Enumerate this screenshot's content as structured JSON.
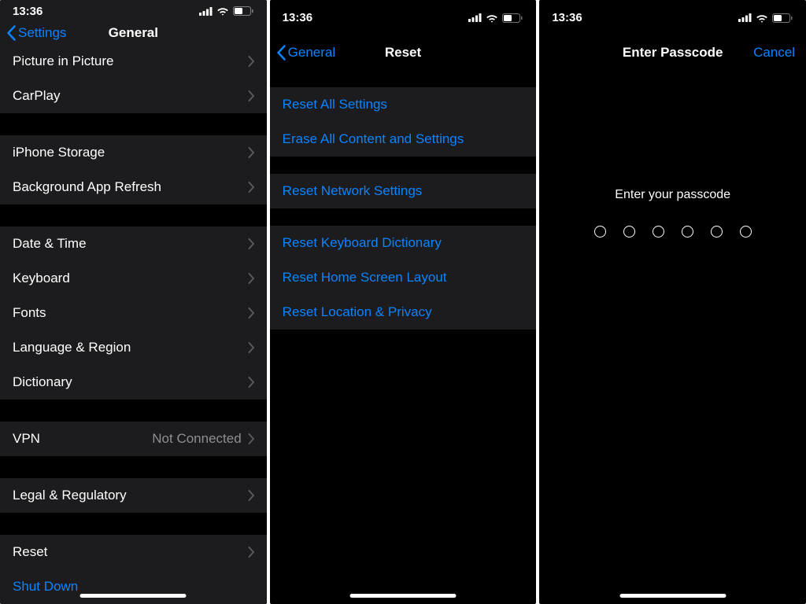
{
  "status": {
    "time": "13:36"
  },
  "screen1": {
    "back": "Settings",
    "title": "General",
    "rows": {
      "pip": "Picture in Picture",
      "carplay": "CarPlay",
      "storage": "iPhone Storage",
      "bgrefresh": "Background App Refresh",
      "datetime": "Date & Time",
      "keyboard": "Keyboard",
      "fonts": "Fonts",
      "langregion": "Language & Region",
      "dictionary": "Dictionary",
      "vpn": "VPN",
      "vpn_detail": "Not Connected",
      "legal": "Legal & Regulatory",
      "reset": "Reset",
      "shutdown": "Shut Down"
    }
  },
  "screen2": {
    "back": "General",
    "title": "Reset",
    "rows": {
      "reset_all": "Reset All Settings",
      "erase_all": "Erase All Content and Settings",
      "reset_network": "Reset Network Settings",
      "reset_keyboard": "Reset Keyboard Dictionary",
      "reset_home": "Reset Home Screen Layout",
      "reset_location": "Reset Location & Privacy"
    }
  },
  "screen3": {
    "title": "Enter Passcode",
    "cancel": "Cancel",
    "prompt": "Enter your passcode"
  }
}
